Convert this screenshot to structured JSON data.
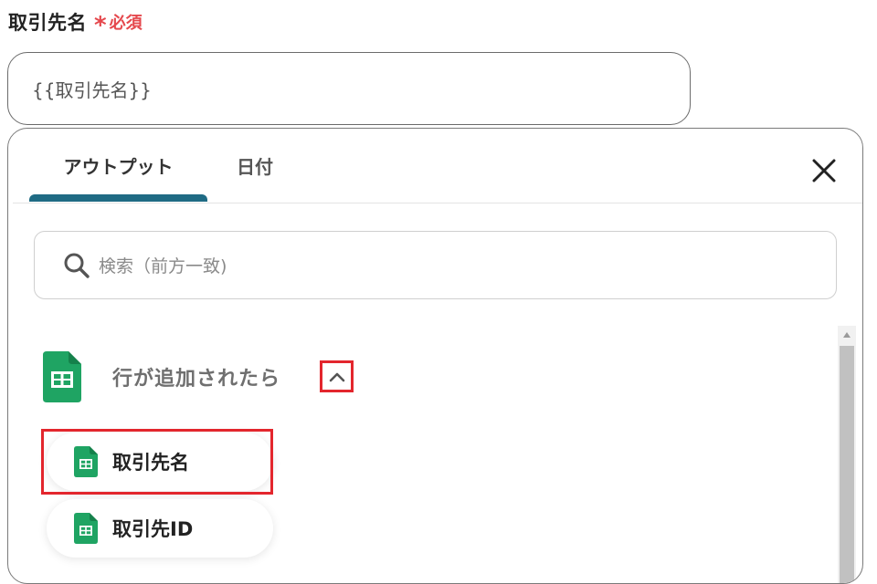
{
  "field": {
    "label": "取引先名",
    "required_mark": "*",
    "required_text": "必須",
    "value": "{{取引先名}}"
  },
  "panel": {
    "tabs": [
      {
        "label": "アウトプット",
        "active": true
      },
      {
        "label": "日付",
        "active": false
      }
    ],
    "search": {
      "placeholder": "検索（前方一致)"
    },
    "group": {
      "title": "行が追加されたら",
      "expanded": true,
      "icon": "google-sheets-icon",
      "items": [
        {
          "label": "取引先名",
          "icon": "google-sheets-icon",
          "highlighted": true
        },
        {
          "label": "取引先ID",
          "icon": "google-sheets-icon",
          "highlighted": false
        }
      ]
    }
  },
  "colors": {
    "accent_tab": "#1f6b84",
    "required": "#e5484d",
    "highlight_box": "#e3262d",
    "sheets_green": "#1fa463"
  }
}
